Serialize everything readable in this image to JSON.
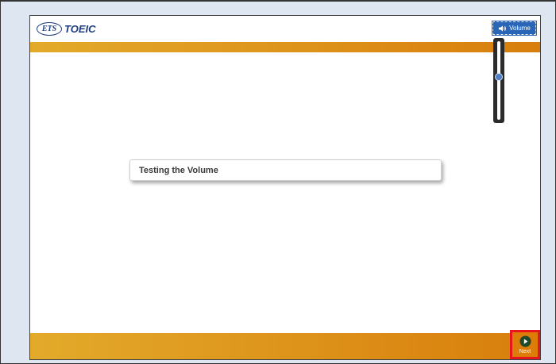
{
  "header": {
    "logo_mark": "ETS",
    "logo_text": "TOEIC"
  },
  "volume": {
    "label": "Volume",
    "icon": "speaker-icon",
    "level": 0.55
  },
  "content": {
    "title": "Testing the Volume"
  },
  "footer": {
    "next_label": "Next",
    "next_icon": "play-circle-icon"
  },
  "colors": {
    "bar_start": "#e3aa2a",
    "bar_end": "#d87e0c",
    "volume_button": "#2a66b8",
    "next_highlight": "#e8151b",
    "page_background": "#dde6f1"
  }
}
